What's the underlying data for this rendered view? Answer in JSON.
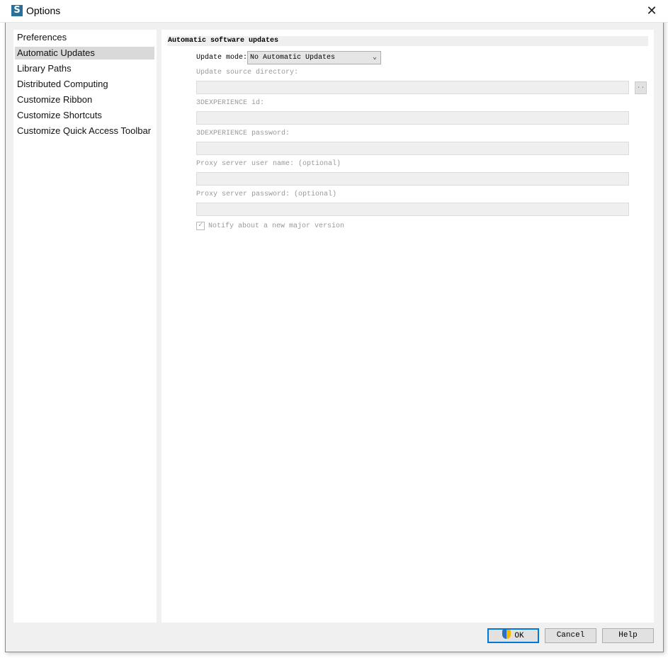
{
  "window": {
    "title": "Options",
    "app_icon": "S",
    "close_icon": "✕"
  },
  "sidebar": {
    "items": [
      {
        "label": "Preferences"
      },
      {
        "label": "Automatic Updates",
        "selected": true
      },
      {
        "label": "Library Paths"
      },
      {
        "label": "Distributed Computing"
      },
      {
        "label": "Customize Ribbon"
      },
      {
        "label": "Customize Shortcuts"
      },
      {
        "label": "Customize Quick Access Toolbar"
      }
    ]
  },
  "main": {
    "section_title": "Automatic software updates",
    "update_mode_label": "Update mode:",
    "update_mode_value": "No Automatic Updates",
    "source_dir_label": "Update source directory:",
    "source_dir_value": "",
    "browse_label": "..",
    "id_label": "3DEXPERIENCE id:",
    "id_value": "",
    "password_label": "3DEXPERIENCE password:",
    "password_value": "",
    "proxy_user_label": "Proxy server user name: (optional)",
    "proxy_user_value": "",
    "proxy_password_label": "Proxy server password: (optional)",
    "proxy_password_value": "",
    "notify_label": "Notify about a new major version",
    "notify_checked": true
  },
  "buttons": {
    "ok": "OK",
    "cancel": "Cancel",
    "help": "Help"
  },
  "colors": {
    "accent": "#0078d7",
    "selection": "#d9d9d9"
  }
}
